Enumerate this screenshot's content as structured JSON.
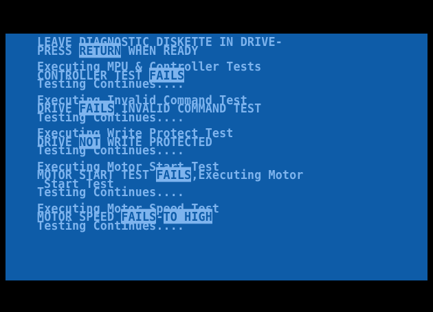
{
  "colors": {
    "screen_bg": "#0e5ca8",
    "text": "#7eb4ee",
    "border": "#000000"
  },
  "prompt": {
    "line1": "LEAVE DIAGNOSTIC DISKETTE IN DRIVE-",
    "line2_pre": "PRESS ",
    "line2_key": "RETURN",
    "line2_post": " WHEN READY"
  },
  "tests": {
    "mpu": {
      "title": "Executing MPU & Controller Tests",
      "result_pre": "CONTROLLER TEST ",
      "result_flag": "FAILS",
      "status": "Testing Continues...."
    },
    "invalid_command": {
      "title": "Executing Invalid Command Test",
      "result_pre": "DRIVE ",
      "result_flag": "FAILS",
      "result_post": " INVALID COMMAND TEST",
      "status": "Testing Continues...."
    },
    "write_protect": {
      "title": "Executing Write Protect Test",
      "result_pre": "DRIVE ",
      "result_flag": "NOT",
      "result_post": " WRITE PROTECTED",
      "status": "Testing Continues...."
    },
    "motor_start": {
      "title": "Executing Motor Start Test",
      "result_pre": "MOTOR START TEST ",
      "result_flag": "FAILS",
      "result_post": ",Executing Motor",
      "result_cont": "Start Test",
      "status": "Testing Continues...."
    },
    "motor_speed": {
      "title": "Executing Motor Speed Test",
      "result_pre": "MOTOR SPEED ",
      "result_flag": "FAILS",
      "result_sep": "-",
      "result_flag2": "TO HIGH",
      "status": "Testing Continues...."
    }
  }
}
